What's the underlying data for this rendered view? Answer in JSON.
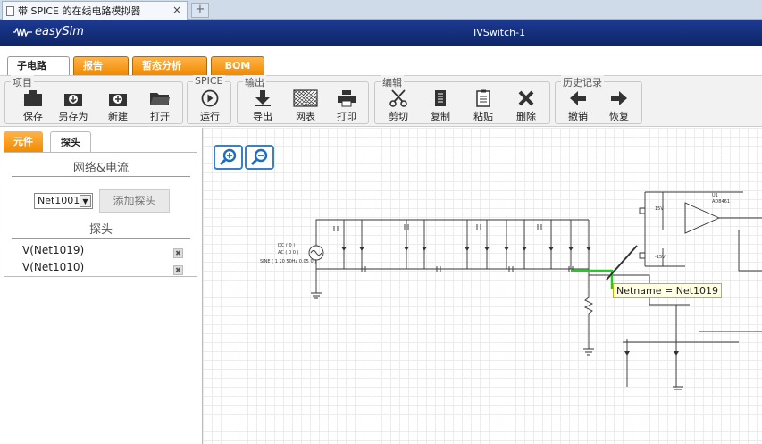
{
  "browser": {
    "tab_title": "带 SPICE 的在线电路模拟器",
    "tab_close": "×",
    "new_tab": "+"
  },
  "app": {
    "logo_text": "easySim",
    "document_title": "IVSwitch-1"
  },
  "tabs": [
    {
      "label": "子电路",
      "closable": false
    },
    {
      "label": "报告",
      "closable": true
    },
    {
      "label": "暂态分析",
      "closable": true
    },
    {
      "label": "BOM",
      "closable": false
    }
  ],
  "tab_close_glyph": "✖",
  "ribbon": {
    "groups": {
      "project": "项目",
      "spice": "SPICE",
      "output": "输出",
      "edit": "编辑",
      "history": "历史记录"
    },
    "buttons": {
      "save": "保存",
      "save_as": "另存为",
      "new": "新建",
      "open": "打开",
      "run": "运行",
      "export": "导出",
      "netlist": "网表",
      "print": "打印",
      "cut": "剪切",
      "copy": "复制",
      "paste": "粘贴",
      "delete": "删除",
      "undo": "撤销",
      "redo": "恢复"
    }
  },
  "sidebar": {
    "tabs": [
      "元件",
      "探头"
    ],
    "net_current_heading": "网络&电流",
    "net_select_value": "Net1001",
    "add_probe_label": "添加探头",
    "probes_heading": "探头",
    "probes": [
      "V(Net1019)",
      "V(Net1010)"
    ],
    "delete_glyph": "✖"
  },
  "canvas": {
    "tooltip": "Netname = Net1019",
    "source_labels": [
      "DC ( 0 )",
      "AC ( 0 0 )",
      "SINE ( 1 20 50Hz 0.05 0 )"
    ],
    "opamp_labels": [
      "U1",
      "AD8461",
      "15V",
      "-15V"
    ]
  },
  "colors": {
    "brand_blue": "#1d3a93",
    "accent_orange": "#f08a00",
    "highlight_net": "#22cc22",
    "tooltip_border": "#f0a000"
  }
}
